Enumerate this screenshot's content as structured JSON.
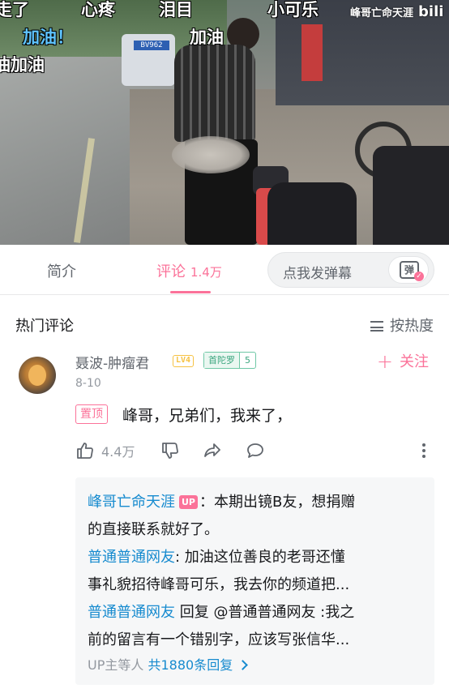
{
  "video": {
    "danmaku": [
      {
        "text": "走了",
        "style": "white"
      },
      {
        "text": "心疼",
        "style": "white"
      },
      {
        "text": "泪目",
        "style": "white"
      },
      {
        "text": "小可乐",
        "style": "white"
      },
      {
        "text": "加油！",
        "style": "blue"
      },
      {
        "text": "加油",
        "style": "white"
      },
      {
        "text": "油加油",
        "style": "white"
      }
    ],
    "watermark_user": "峰哥亡命天涯",
    "watermark_logo": "bili",
    "van_plate": "BV962"
  },
  "tabs": {
    "intro_label": "简介",
    "comment_label": "评论",
    "comment_count": "1.4万",
    "danmu_placeholder": "点我发弹幕",
    "danmu_glyph": "弹"
  },
  "comments_header": {
    "title": "热门评论",
    "sort_label": "按热度"
  },
  "comment": {
    "username": "聂波-肿瘤君",
    "level": "LV4",
    "medal_name": "首陀罗",
    "medal_level": "5",
    "follow_label": "关注",
    "date": "8-10",
    "pinned_label": "置顶",
    "content": "峰哥，兄弟们，我来了，",
    "likes": "4.4万"
  },
  "replies": {
    "lines": [
      {
        "who": "峰哥亡命天涯",
        "up_badge": "UP",
        "text": "：本期出镜B友，想捐赠"
      },
      {
        "who": "",
        "up_badge": "",
        "text": "的直接联系就好了。"
      },
      {
        "who": "普通普通网友",
        "up_badge": "",
        "text": ": 加油这位善良的老哥还懂"
      },
      {
        "who": "",
        "up_badge": "",
        "text": "事礼貌招待峰哥可乐，我去你的频道把..."
      },
      {
        "who": "普通普通网友",
        "up_badge": "",
        "text": " 回复 @普通普通网友 :我之"
      },
      {
        "who": "",
        "up_badge": "",
        "text": "前的留言有一个错别字，应该写张信华..."
      }
    ],
    "total_prefix": "UP主等人",
    "total_link": "共1880条回复"
  },
  "colors": {
    "accent": "#fb7299",
    "link": "#178bcf",
    "muted": "#9499a0"
  }
}
